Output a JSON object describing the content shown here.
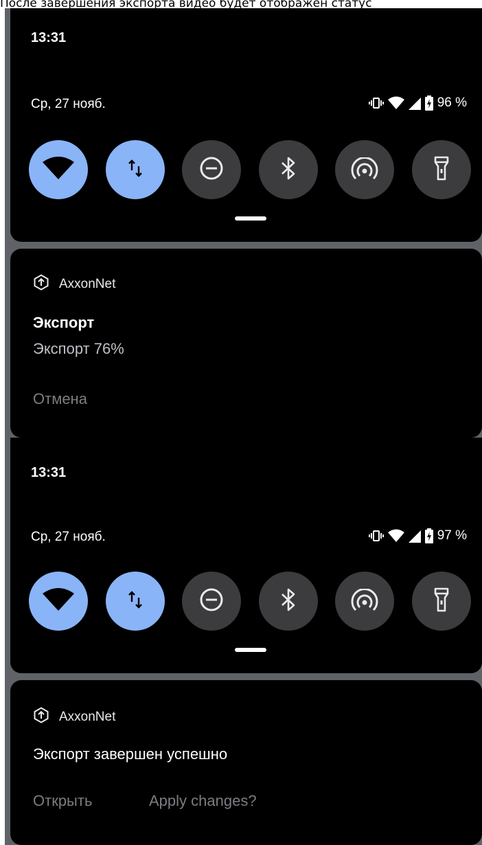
{
  "caption": "После завершения экспорта видео будет отображен статус",
  "screens": [
    {
      "time": "13:31",
      "date": "Ср, 27 нояб.",
      "battery": "96 %",
      "notification": {
        "app": "AxxonNet",
        "title": "Экспорт",
        "text": "Экспорт 76%",
        "actions": [
          "Отмена"
        ]
      }
    },
    {
      "time": "13:31",
      "date": "Ср, 27 нояб.",
      "battery": "97 %",
      "notification": {
        "app": "AxxonNet",
        "title": "Экспорт завершен успешно",
        "actions": [
          "Открыть",
          "Apply changes?"
        ]
      }
    }
  ],
  "quick_tiles": [
    {
      "icon": "wifi-icon",
      "active": true
    },
    {
      "icon": "mobile-data-icon",
      "active": true
    },
    {
      "icon": "do-not-disturb-icon",
      "active": false
    },
    {
      "icon": "bluetooth-icon",
      "active": false
    },
    {
      "icon": "hotspot-icon",
      "active": false
    },
    {
      "icon": "flashlight-icon",
      "active": false
    }
  ],
  "colors": {
    "tile_active": "#8ab4f8",
    "tile_inactive": "#3c3c3e",
    "panel": "#000000",
    "action_text": "#7a7d82"
  }
}
